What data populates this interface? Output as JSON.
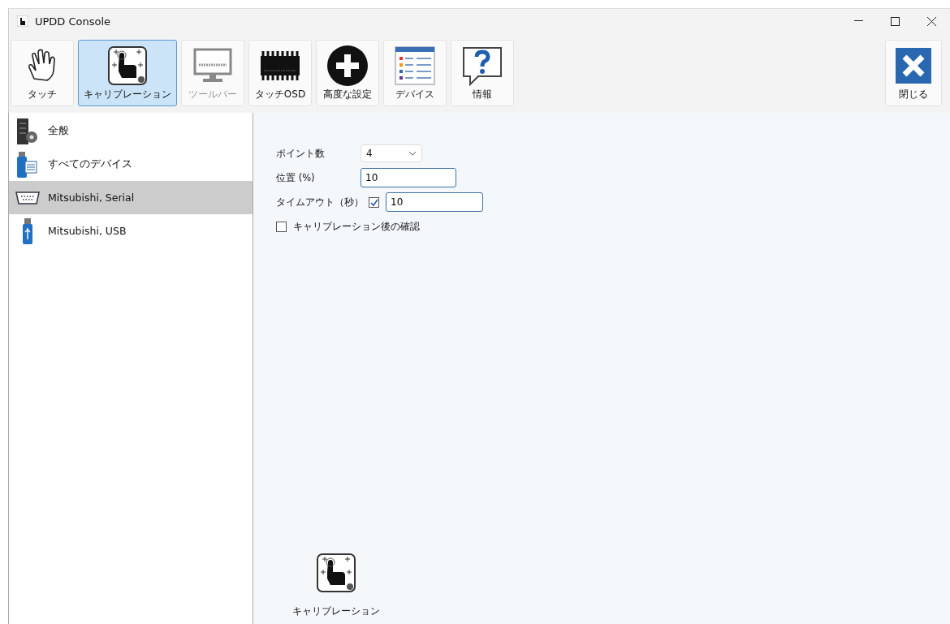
{
  "window": {
    "title": "UPDD Console"
  },
  "toolbar": [
    {
      "kind": "hand",
      "label": "タッチ",
      "selected": false,
      "disabled": false
    },
    {
      "kind": "calibrate",
      "label": "キャリブレーション",
      "selected": true,
      "disabled": false
    },
    {
      "kind": "monitor",
      "label": "ツールバー",
      "selected": false,
      "disabled": true
    },
    {
      "kind": "chip",
      "label": "タッチOSD",
      "selected": false,
      "disabled": false
    },
    {
      "kind": "plus",
      "label": "高度な設定",
      "selected": false,
      "disabled": false
    },
    {
      "kind": "table",
      "label": "デバイス",
      "selected": false,
      "disabled": false
    },
    {
      "kind": "help",
      "label": "情報",
      "selected": false,
      "disabled": false
    }
  ],
  "close_button": {
    "label": "閉じる"
  },
  "sidebar": {
    "items": [
      {
        "kind": "server",
        "label": "全般",
        "selected": false
      },
      {
        "kind": "usblist",
        "label": "すべてのデバイス",
        "selected": false
      },
      {
        "kind": "serial",
        "label": "Mitsubishi, Serial",
        "selected": true
      },
      {
        "kind": "usb",
        "label": "Mitsubishi, USB",
        "selected": false
      }
    ]
  },
  "form": {
    "points": {
      "label": "ポイント数",
      "value": "4"
    },
    "position": {
      "label": "位置 (%)",
      "value": "10"
    },
    "timeout": {
      "label": "タイムアウト（秒）",
      "checked": true,
      "value": "10"
    },
    "confirm": {
      "label": "キャリブレーション後の確認",
      "checked": false
    }
  },
  "calibrate_button": {
    "label": "キャリブレーション"
  }
}
